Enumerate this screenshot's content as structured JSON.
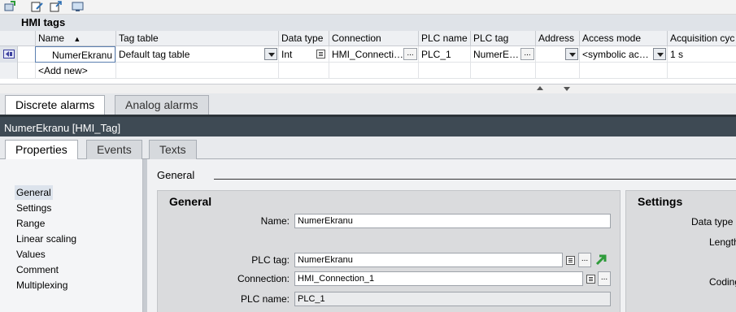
{
  "toolbar": {
    "icons": [
      "add-tag-icon",
      "edit-icon",
      "export-icon",
      "monitor-icon"
    ]
  },
  "hmi_tags": {
    "title": "HMI tags",
    "columns": [
      "Name",
      "Tag table",
      "Data type",
      "Connection",
      "PLC name",
      "PLC tag",
      "Address",
      "Access mode",
      "Acquisition cyc"
    ],
    "sort_indicator": "▲",
    "rows": [
      {
        "name": "NumerEkranu",
        "tag_table": "Default tag table",
        "data_type": "Int",
        "connection": "HMI_Connecti…",
        "plc_name": "PLC_1",
        "plc_tag": "NumerE…",
        "address": "",
        "access_mode": "<symbolic ac…",
        "acquisition": "1 s"
      }
    ],
    "add_new": "<Add new>"
  },
  "alarm_tabs": [
    "Discrete alarms",
    "Analog alarms"
  ],
  "inspector": {
    "title": "NumerEkranu [HMI_Tag]",
    "tabs": [
      "Properties",
      "Events",
      "Texts"
    ]
  },
  "nav": {
    "items": [
      "General",
      "Settings",
      "Range",
      "Linear scaling",
      "Values",
      "Comment",
      "Multiplexing"
    ],
    "selected": "General"
  },
  "content": {
    "section": "General",
    "general_box": {
      "title": "General",
      "name_label": "Name:",
      "name_value": "NumerEkranu",
      "plc_tag_label": "PLC tag:",
      "plc_tag_value": "NumerEkranu",
      "connection_label": "Connection:",
      "connection_value": "HMI_Connection_1",
      "plc_name_label": "PLC name:",
      "plc_name_value": "PLC_1"
    },
    "settings_box": {
      "title": "Settings",
      "data_type_label": "Data type",
      "length_label": "Length",
      "coding_label": "Coding"
    }
  },
  "colors": {
    "inspector_bar": "#3e4a54",
    "accent_arrow": "#2e9b3a"
  }
}
